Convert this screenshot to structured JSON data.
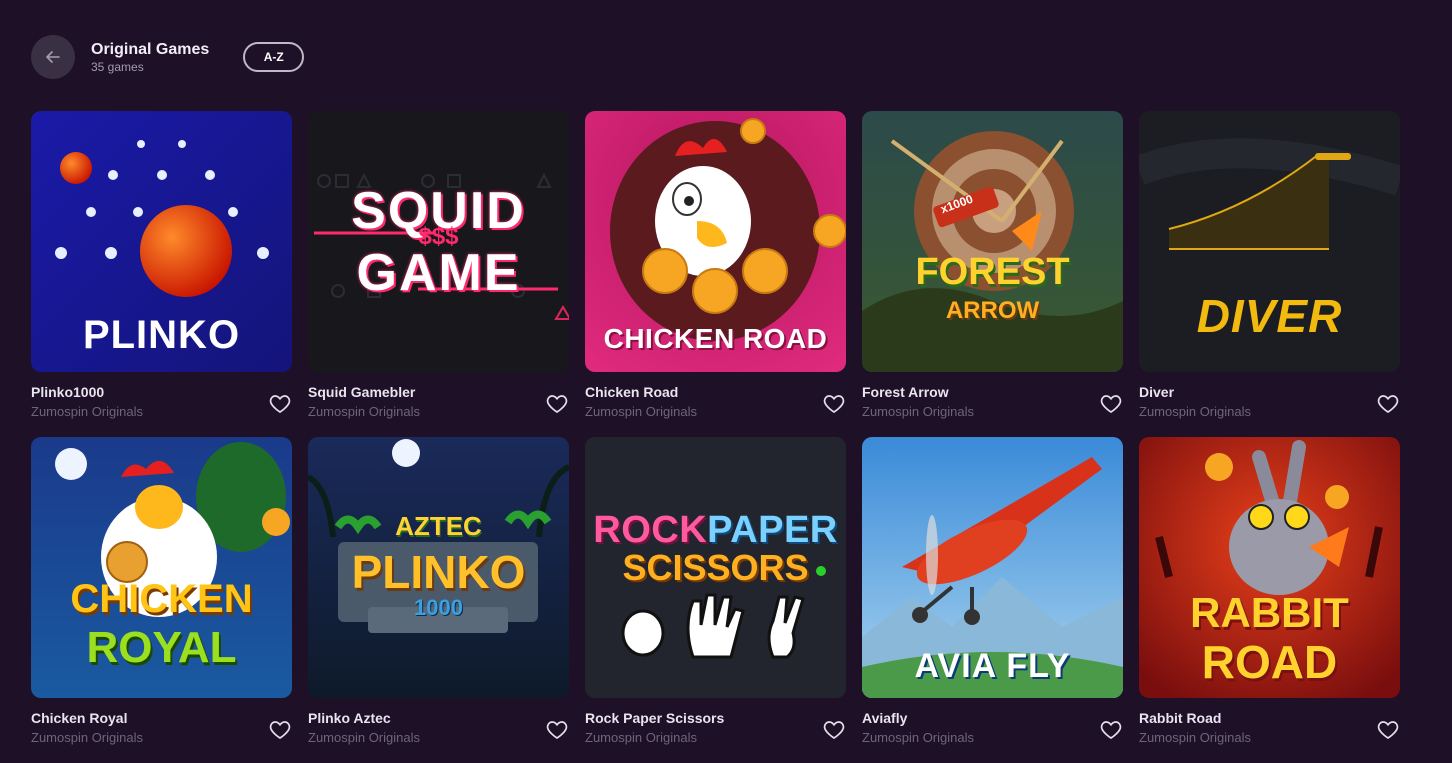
{
  "header": {
    "title": "Original Games",
    "count": "35 games",
    "sort_label": "A-Z"
  },
  "icons": {
    "back": "arrow-left-icon",
    "favorite": "heart-outline-icon"
  },
  "colors": {
    "background": "#1d1027",
    "back_button": "#3a3044",
    "provider_text": "#6f6579"
  },
  "games": [
    {
      "name": "Plinko1000",
      "provider": "Zumospin Originals",
      "art": "PLINKO"
    },
    {
      "name": "Squid Gamebler",
      "provider": "Zumospin Originals",
      "art_line1": "SQUID",
      "art_mid": "$$$",
      "art_line2": "GAME"
    },
    {
      "name": "Chicken Road",
      "provider": "Zumospin Originals",
      "art": "CHICKEN ROAD"
    },
    {
      "name": "Forest Arrow",
      "provider": "Zumospin Originals",
      "art_line1": "FOREST",
      "art_line2": "ARROW",
      "art_badge": "x1000"
    },
    {
      "name": "Diver",
      "provider": "Zumospin Originals",
      "art": "DIVER"
    },
    {
      "name": "Chicken Royal",
      "provider": "Zumospin Originals",
      "art_line1": "CHICKEN",
      "art_line2": "ROYAL"
    },
    {
      "name": "Plinko Aztec",
      "provider": "Zumospin Originals",
      "art_line1": "AZTEC",
      "art_line2": "PLINKO",
      "art_line3": "1000"
    },
    {
      "name": "Rock Paper Scissors",
      "provider": "Zumospin Originals",
      "art_line1a": "ROCK",
      "art_line1b": "PAPER",
      "art_line2": "SCISSORS"
    },
    {
      "name": "Aviafly",
      "provider": "Zumospin Originals",
      "art": "AVIA FLY"
    },
    {
      "name": "Rabbit Road",
      "provider": "Zumospin Originals",
      "art_line1": "RABBIT",
      "art_line2": "ROAD"
    }
  ]
}
